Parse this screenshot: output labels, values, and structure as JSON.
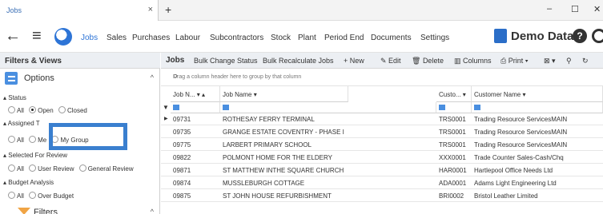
{
  "tab": {
    "title": "Jobs",
    "close": "×",
    "new": "+"
  },
  "window": {
    "minimize": "–",
    "maximize": "☐",
    "close": "✕"
  },
  "nav": {
    "menu": [
      "Jobs",
      "Sales",
      "Purchases",
      "Labour",
      "Subcontractors",
      "Stock",
      "Plant",
      "Period End",
      "Documents",
      "Settings"
    ],
    "active": "Jobs",
    "company": "Demo Data"
  },
  "left": {
    "header": "Filters & Views",
    "options_label": "Options",
    "status_label": "Status",
    "status_options": [
      "All",
      "Open",
      "Closed"
    ],
    "status_selected": "Open",
    "assigned_label": "Assigned T",
    "assigned_options": [
      "All",
      "Me",
      "My Group"
    ],
    "review_label": "Selected For Review",
    "review_options": [
      "All",
      "User Review",
      "General Review"
    ],
    "budget_label": "Budget Analysis",
    "budget_options": [
      "All",
      "Over Budget"
    ],
    "filters_label": "Filters"
  },
  "toolbar": {
    "title": "Jobs",
    "bulk_change": "Bulk Change Status",
    "bulk_recalc": "Bulk Recalculate Jobs",
    "new": "New",
    "edit": "Edit",
    "delete": "Delete",
    "columns": "Columns",
    "print": "Print"
  },
  "grid": {
    "group_hint": "Drag a column header here to group by that column",
    "columns": [
      "Job N...",
      "Job Name",
      "Custo...",
      "Customer Name"
    ],
    "rows": [
      [
        "09731",
        "ROTHESAY FERRY TERMINAL",
        "TRS0001",
        "Trading Resource ServicesMAIN"
      ],
      [
        "09735",
        "GRANGE ESTATE COVENTRY - PHASE I",
        "TRS0001",
        "Trading Resource ServicesMAIN"
      ],
      [
        "09775",
        "LARBERT PRIMARY SCHOOL",
        "TRS0001",
        "Trading Resource ServicesMAIN"
      ],
      [
        "09822",
        "POLMONT HOME FOR THE ELDERY",
        "XXX0001",
        "Trade Counter Sales-Cash/Chq"
      ],
      [
        "09871",
        "ST MATTHEW INTHE SQUARE CHURCH",
        "HAR0001",
        "Hartlepool Office Needs Ltd"
      ],
      [
        "09874",
        "MUSSLEBURGH COTTAGE",
        "ADA0001",
        "Adams Light Engineering Ltd"
      ],
      [
        "09875",
        "ST JOHN HOUSE REFURBISHMENT",
        "BRI0002",
        "Bristol Leather Limited"
      ]
    ]
  }
}
